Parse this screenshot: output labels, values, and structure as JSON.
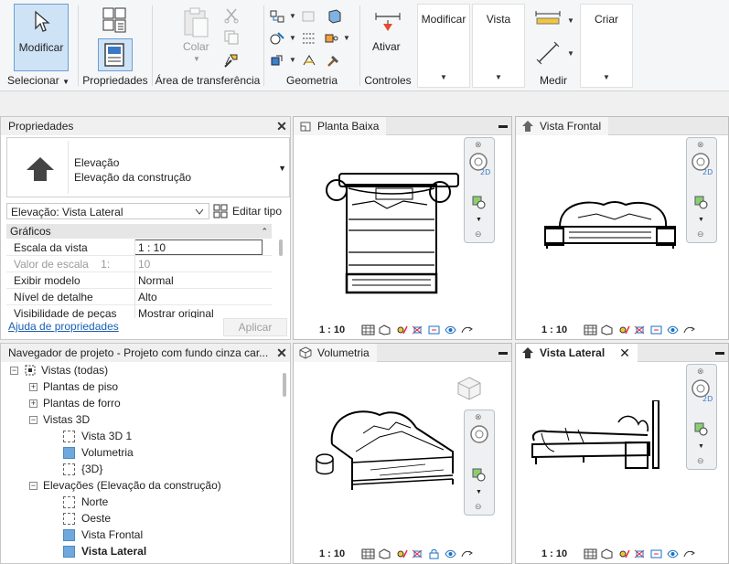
{
  "ribbon": {
    "modificar_label": "Modificar",
    "groups": {
      "selecionar": "Selecionar",
      "propriedades": "Propriedades",
      "transferencia": "Área de transferência",
      "geometria": "Geometria",
      "controles": "Controles",
      "medir": "Medir"
    },
    "colar_label": "Colar",
    "ativar_label": "Ativar",
    "panels": {
      "modificar": "Modificar",
      "vista": "Vista",
      "criar": "Criar"
    }
  },
  "properties": {
    "title": "Propriedades",
    "type_name": "Elevação",
    "type_subname": "Elevação da construção",
    "selector_value": "Elevação: Vista Lateral",
    "edit_type": "Editar tipo",
    "section": "Gráficos",
    "rows": [
      {
        "label": "Escala da vista",
        "value": "1 : 10"
      },
      {
        "label": "Valor de escala    1:",
        "value": "10"
      },
      {
        "label": "Exibir modelo",
        "value": "Normal"
      },
      {
        "label": "Nível de detalhe",
        "value": "Alto"
      },
      {
        "label": "Visibilidade de peças",
        "value": "Mostrar original"
      }
    ],
    "help_link": "Ajuda de propriedades",
    "apply": "Aplicar"
  },
  "navigator": {
    "title": "Navegador de projeto - Projeto com fundo cinza car...",
    "items": [
      {
        "label": "Vistas (todas)"
      },
      {
        "label": "Plantas de piso"
      },
      {
        "label": "Plantas de forro"
      },
      {
        "label": "Vistas 3D"
      },
      {
        "label": "Vista 3D 1"
      },
      {
        "label": "Volumetria"
      },
      {
        "label": "{3D}"
      },
      {
        "label": "Elevações (Elevação da construção)"
      },
      {
        "label": "Norte"
      },
      {
        "label": "Oeste"
      },
      {
        "label": "Vista Frontal"
      },
      {
        "label": "Vista Lateral"
      }
    ]
  },
  "views": {
    "planta": {
      "title": "Planta Baixa",
      "scale": "1 : 10"
    },
    "frontal": {
      "title": "Vista Frontal",
      "scale": "1 : 10"
    },
    "volumetria": {
      "title": "Volumetria",
      "scale": "1 : 10"
    },
    "lateral": {
      "title": "Vista Lateral",
      "scale": "1 : 10"
    }
  },
  "icons": {
    "accent": "#cfe3f7",
    "accent_border": "#6a9fd4",
    "selected_box": "#6ea8dc"
  }
}
